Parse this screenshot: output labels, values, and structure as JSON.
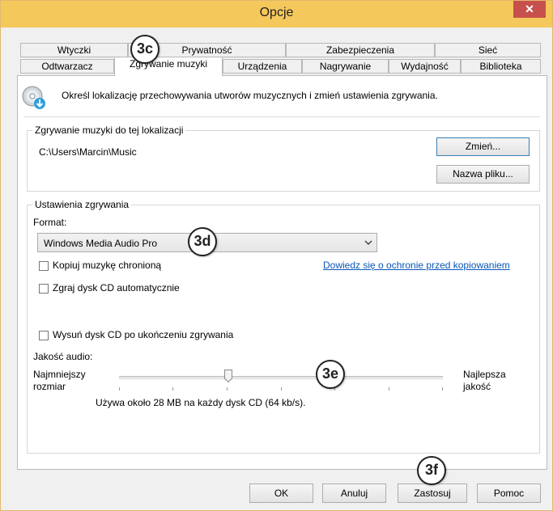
{
  "window": {
    "title": "Opcje",
    "close_label": "✕"
  },
  "tabs_row1": [
    "Wtyczki",
    "Prywatność",
    "Zabezpieczenia",
    "Sieć"
  ],
  "tabs_row2": [
    "Odtwarzacz",
    "Zgrywanie muzyki",
    "Urządzenia",
    "Nagrywanie",
    "Wydajność",
    "Biblioteka"
  ],
  "active_tab": "Zgrywanie muzyki",
  "description": "Określ lokalizację przechowywania utworów muzycznych i zmień ustawienia zgrywania.",
  "location_group": {
    "legend": "Zgrywanie muzyki do tej lokalizacji",
    "path": "C:\\Users\\Marcin\\Music",
    "change_button": "Zmień...",
    "filename_button": "Nazwa pliku..."
  },
  "settings_group": {
    "legend": "Ustawienia zgrywania",
    "format_label": "Format:",
    "format_value": "Windows Media Audio Pro",
    "copy_protect_label": "Kopiuj muzykę chronioną",
    "copy_protect_checked": false,
    "learn_link": "Dowiedz się o ochronie przed kopiowaniem",
    "auto_rip_label": "Zgraj dysk CD automatycznie",
    "auto_rip_checked": false,
    "eject_label": "Wysuń dysk CD po ukończeniu zgrywania",
    "eject_checked": false,
    "quality_label": "Jakość audio:",
    "quality_min_label": "Najmniejszy rozmiar",
    "quality_max_label": "Najlepsza jakość",
    "quality_level": 0.33,
    "usage_text": "Używa około 28 MB na każdy dysk CD (64 kb/s)."
  },
  "buttons": {
    "ok": "OK",
    "cancel": "Anuluj",
    "apply": "Zastosuj",
    "help": "Pomoc"
  },
  "callouts": {
    "c1": "3c",
    "c2": "3d",
    "c3": "3e",
    "c4": "3f"
  },
  "colors": {
    "title_bar": "#f5c85c",
    "close_button": "#c7504c",
    "link": "#0a56b8"
  }
}
